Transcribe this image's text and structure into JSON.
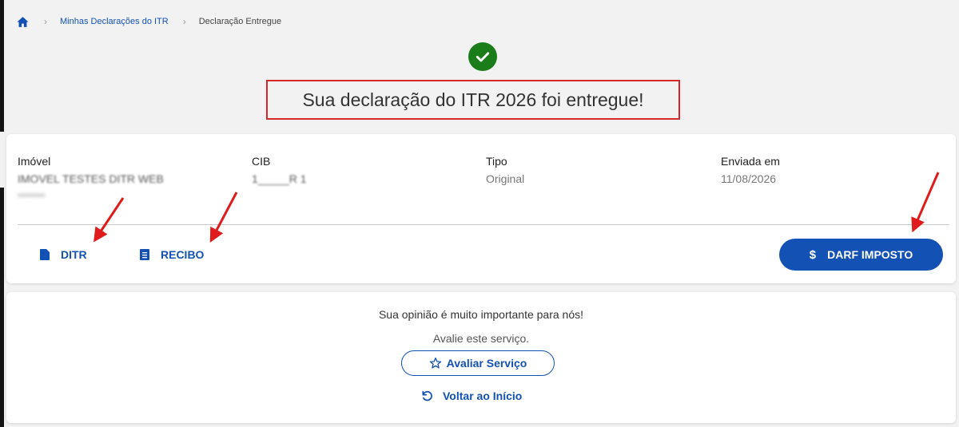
{
  "breadcrumb": {
    "items": [
      "Minhas Declarações do ITR",
      "Declaração Entregue"
    ]
  },
  "success": {
    "title": "Sua declaração do ITR 2026 foi entregue!"
  },
  "summary": {
    "imovel_label": "Imóvel",
    "imovel_value": "IMOVEL TESTES DITR WEB",
    "cib_label": "CIB",
    "cib_value": "1_____R 1",
    "tipo_label": "Tipo",
    "tipo_value": "Original",
    "enviada_label": "Enviada em",
    "enviada_value": "11/08/2026"
  },
  "actions": {
    "ditr": "DITR",
    "recibo": "RECIBO",
    "darf": "DARF IMPOSTO",
    "darf_symbol": "$"
  },
  "feedback": {
    "title": "Sua opinião é muito importante para nós!",
    "subtitle": "Avalie este serviço.",
    "rate_button": "Avaliar Serviço",
    "back_link": "Voltar ao Início"
  },
  "colors": {
    "primary": "#1351b4",
    "success": "#1a7d1a",
    "highlight": "#d62828"
  }
}
